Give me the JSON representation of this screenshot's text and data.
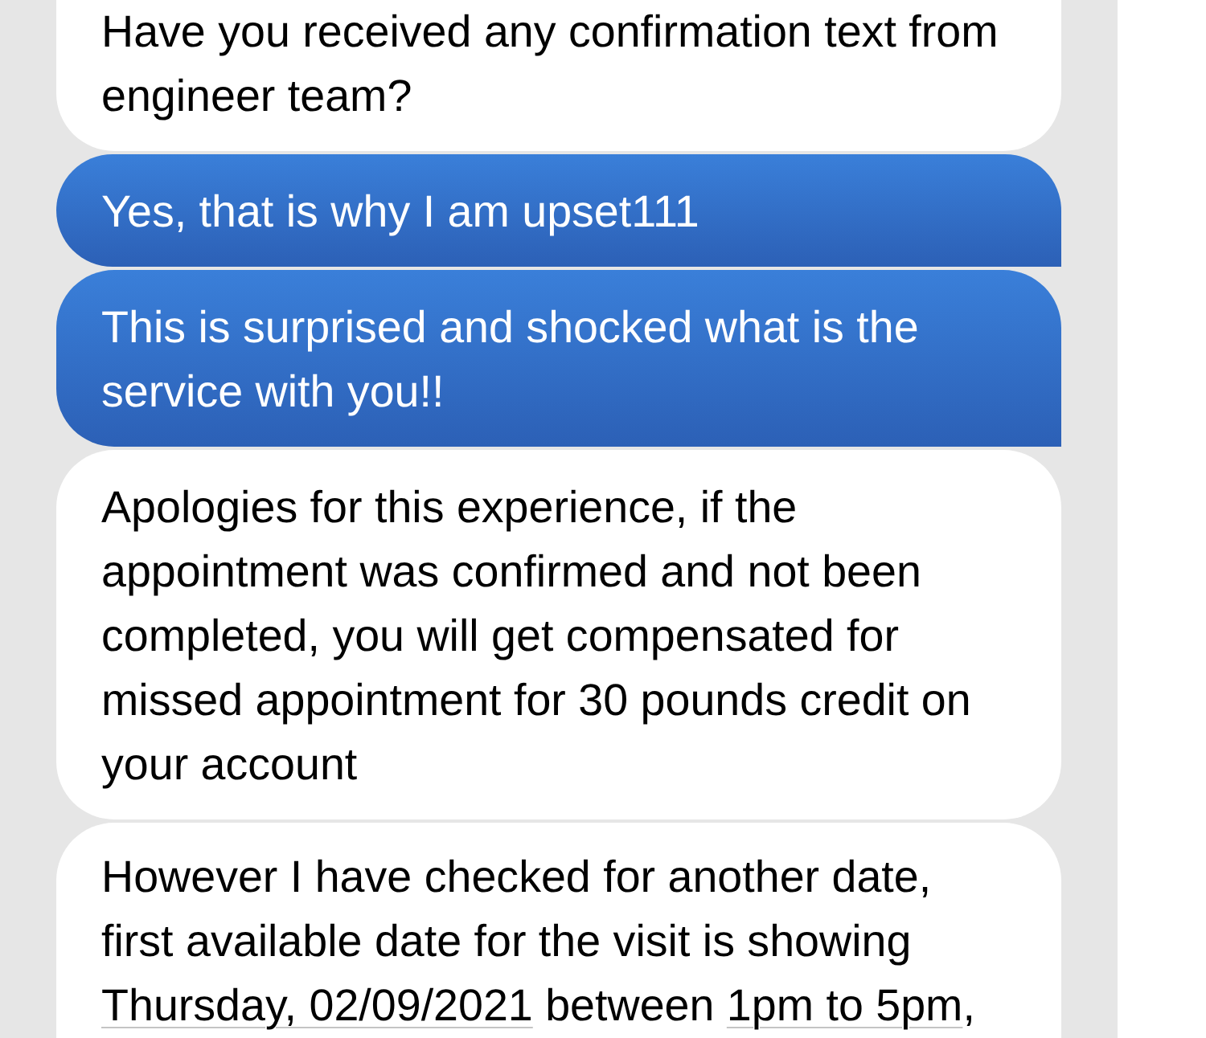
{
  "messages": [
    {
      "kind": "received",
      "text": "Have you received any confirmation text from engineer team?"
    },
    {
      "kind": "sent",
      "text": "Yes, that is why I am upset111"
    },
    {
      "kind": "sent",
      "text": "This is surprised and shocked what is the service with you!!"
    },
    {
      "kind": "received",
      "text": "Apologies for this experience, if the appointment was confirmed and not been completed, you will get compensated for missed appointment for 30 pounds credit on your account"
    },
    {
      "kind": "received",
      "parts": [
        {
          "kind": "plain",
          "text": "However I have checked for another date, first available date for the visit is showing "
        },
        {
          "kind": "link",
          "text": "Thursday, 02/09/2021"
        },
        {
          "kind": "plain",
          "text": " between "
        },
        {
          "kind": "link",
          "text": "1pm to 5pm"
        },
        {
          "kind": "plain",
          "text": ","
        }
      ]
    }
  ]
}
